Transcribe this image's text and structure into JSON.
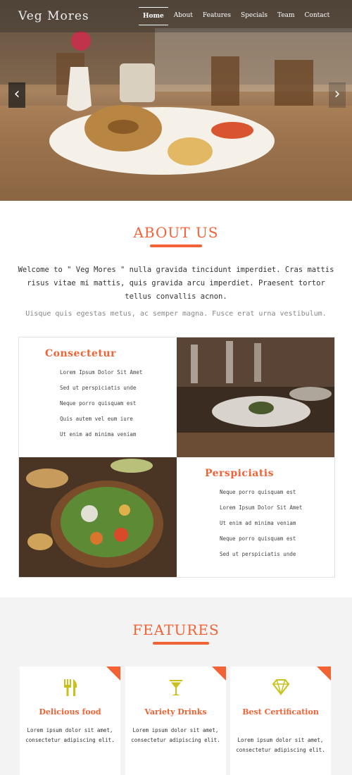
{
  "site": {
    "logo": "Veg Mores"
  },
  "nav": {
    "items": [
      "Home",
      "About",
      "Features",
      "Specials",
      "Team",
      "Contact"
    ],
    "active": "Home"
  },
  "hero": {
    "prev_label": "‹",
    "next_label": "›"
  },
  "about": {
    "title": "ABOUT US",
    "text": "Welcome to \" Veg Mores \" nulla gravida tincidunt imperdiet. Cras mattis risus vitae mi mattis, quis gravida arcu imperdiet. Praesent tortor tellus convallis acnon.",
    "subtext": "Uisque quis egestas metus, ac semper magna. Fusce erat urna vestibulum.",
    "block1": {
      "title": "Consectetur",
      "items": [
        "Lorem Ipsum Dolor Sit Amet",
        "Sed ut perspiciatis unde",
        "Neque porro quisquam est",
        "Quis autem vel eum iure",
        "Ut enim ad minima veniam"
      ]
    },
    "block2": {
      "title": "Perspiciatis",
      "items": [
        "Neque porro quisquam est",
        "Lorem Ipsum Dolor Sit Amet",
        "Ut enim ad minima veniam",
        "Neque porro quisquam est",
        "Sed ut perspiciatis unde"
      ]
    }
  },
  "features": {
    "title": "FEATURES",
    "cards": [
      {
        "icon": "cutlery-icon",
        "title": "Delicious food",
        "text": "Lorem ipsum dolor sit amet, consectetur adipiscing elit."
      },
      {
        "icon": "cocktail-icon",
        "title": "Variety Drinks",
        "text": "Lorem ipsum dolor sit amet, consectetur adipiscing elit."
      },
      {
        "icon": "diamond-icon",
        "title": "Best Certification",
        "text": "Lorem ipsum dolor sit amet, consectetur adipiscing elit."
      }
    ]
  },
  "colors": {
    "accent": "#f26234",
    "icon": "#c9c21e",
    "features_bg": "#f3f3f3"
  }
}
